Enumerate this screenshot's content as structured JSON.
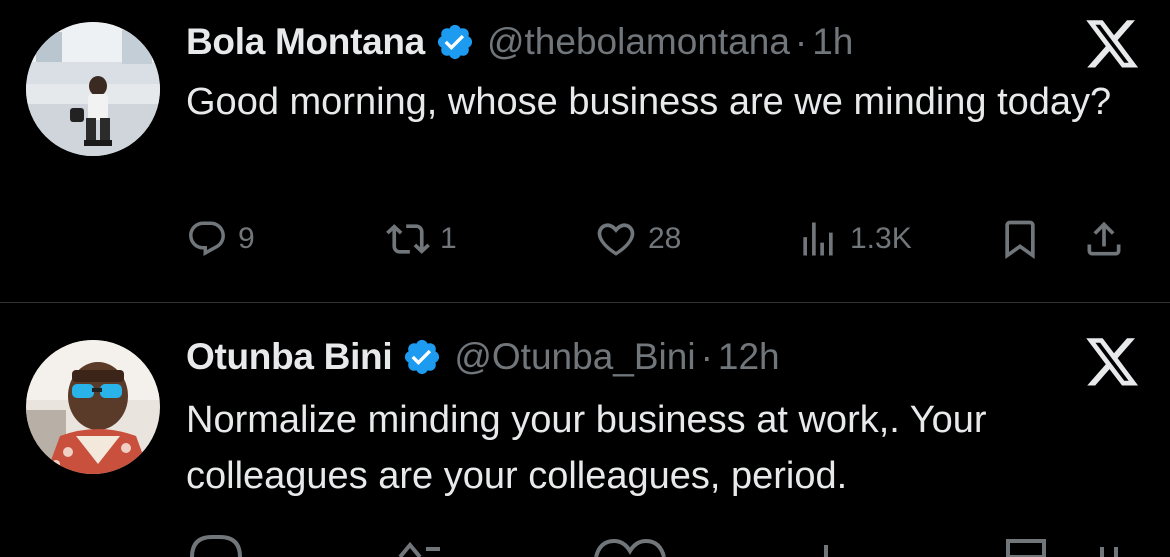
{
  "tweets": [
    {
      "name": "Bola Montana",
      "handle": "@thebolamontana",
      "separator": "·",
      "time": "1h",
      "text": "Good morning, whose business are we minding today?",
      "replies": "9",
      "retweets": "1",
      "likes": "28",
      "views": "1.3K",
      "verified": true,
      "icons": [
        "verified-badge-icon",
        "x-logo-icon",
        "reply-icon",
        "retweet-icon",
        "like-icon",
        "views-icon",
        "bookmark-icon",
        "share-icon"
      ]
    },
    {
      "name": "Otunba Bini",
      "handle": "@Otunba_Bini",
      "separator": "·",
      "time": "12h",
      "text": "Normalize minding your business at work,. Your colleagues are your colleagues, period.",
      "verified": true,
      "icons": [
        "verified-badge-icon",
        "x-logo-icon"
      ]
    }
  ],
  "colors": {
    "background": "#000000",
    "text_primary": "#e7e9ea",
    "text_secondary": "#71767b",
    "verified_blue": "#1d9bf0",
    "divider": "#2f3336"
  }
}
